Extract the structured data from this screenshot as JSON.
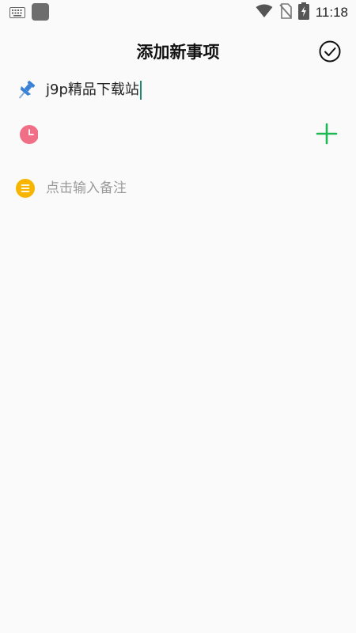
{
  "status_bar": {
    "time": "11:18",
    "icons": [
      "keyboard-icon",
      "app-icon",
      "wifi-icon",
      "no-sim-icon",
      "battery-charging-icon"
    ]
  },
  "header": {
    "title": "添加新事项",
    "confirm_icon": "check-circle-icon"
  },
  "form": {
    "title_icon": "pushpin-icon",
    "title_value": "j9p精品下载站",
    "time_icon": "clock-icon",
    "add_icon": "plus-icon",
    "note_icon": "list-icon",
    "note_placeholder": "点击输入备注"
  },
  "colors": {
    "accent_green": "#1db954",
    "clock_pink": "#f06f86",
    "note_yellow": "#f7b500",
    "pin_blue": "#3b82d6"
  }
}
